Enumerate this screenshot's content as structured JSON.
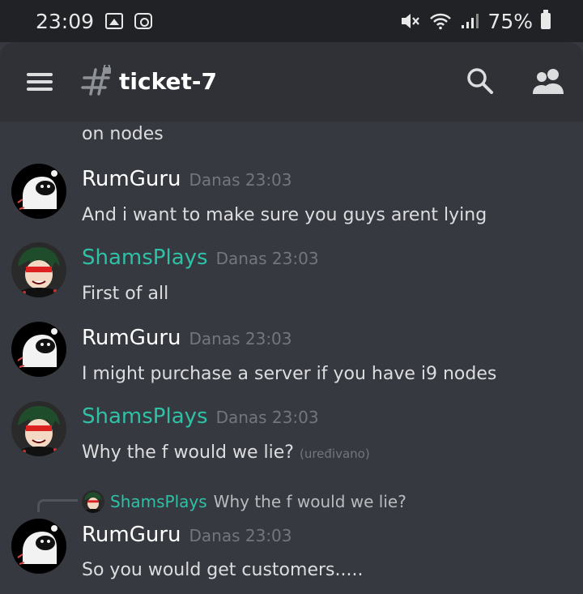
{
  "status_bar": {
    "time": "23:09",
    "battery": "75%",
    "icons": [
      "image-icon",
      "screen-record-icon",
      "mute-icon",
      "wifi-icon",
      "signal-icon",
      "battery-icon"
    ]
  },
  "header": {
    "channel_name": "ticket-7",
    "icons": [
      "menu-icon",
      "locked-channel-icon",
      "search-icon",
      "members-icon"
    ]
  },
  "colors": {
    "rumguru_name": "#ffffff",
    "shamsplays_name": "#2fc1a6",
    "background": "#36393f",
    "header_bg": "#2f3136"
  },
  "continued_text": "on nodes",
  "messages": [
    {
      "author": "RumGuru",
      "timestamp": "Danas 23:03",
      "text": "And i want to make sure you guys arent lying"
    },
    {
      "author": "ShamsPlays",
      "timestamp": "Danas 23:03",
      "text": "First of all"
    },
    {
      "author": "RumGuru",
      "timestamp": "Danas 23:03",
      "text": "I might purchase a server if you have i9 nodes"
    },
    {
      "author": "ShamsPlays",
      "timestamp": "Danas 23:03",
      "text": "Why the f would we lie?",
      "edited": "(uređivano)"
    },
    {
      "author": "RumGuru",
      "timestamp": "Danas 23:03",
      "text": "So you would get customers.....",
      "reply_to": {
        "author": "ShamsPlays",
        "text": "Why the f would we lie?"
      }
    }
  ]
}
